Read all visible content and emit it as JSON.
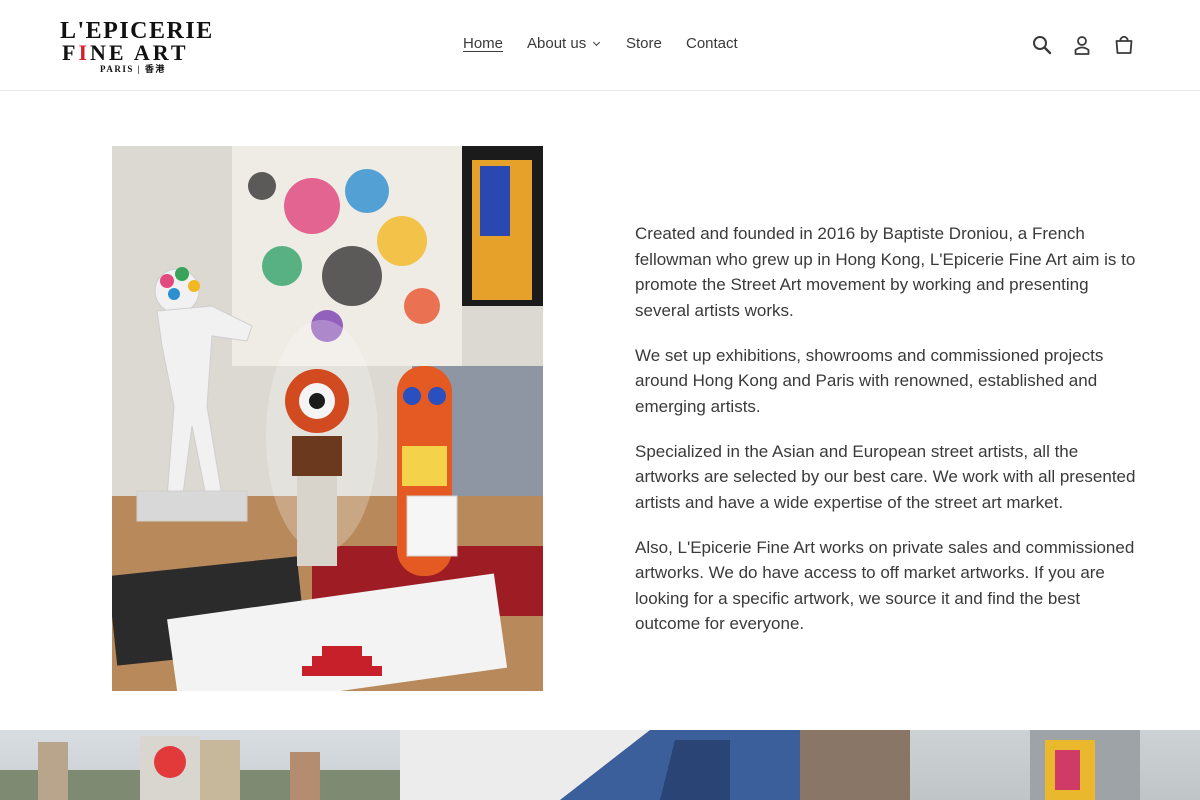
{
  "brand": {
    "logo_line1": "L'EPICERIE",
    "logo_line2_a": "F",
    "logo_line2_b": "NE ART",
    "logo_line3": "PARIS | 香港",
    "accent_color": "#d4202a"
  },
  "nav": {
    "items": [
      {
        "label": "Home",
        "active": true
      },
      {
        "label": "About us",
        "has_dropdown": true
      },
      {
        "label": "Store"
      },
      {
        "label": "Contact"
      }
    ]
  },
  "header_icons": {
    "search": "search-icon",
    "account": "account-icon",
    "cart": "cart-icon"
  },
  "feature": {
    "image_subject": "street art sculptures and artworks",
    "paragraphs": [
      "Created and founded in 2016 by Baptiste Droniou, a French fellowman who grew up in Hong Kong, L'Epicerie Fine Art aim is to promote the Street Art movement by working and presenting several artists works.",
      "We set up exhibitions, showrooms and commissioned projects around Hong Kong and Paris with renowned, established and emerging artists.",
      "Specialized in the Asian and European street artists, all the artworks are selected by our best care. We work with all presented artists and have a wide expertise of the street art market.",
      "Also, L'Epicerie Fine Art works on private sales and commissioned artworks. We do have access to off market artworks. If you are looking for a specific artwork, we source it and find the best outcome for everyone."
    ]
  }
}
